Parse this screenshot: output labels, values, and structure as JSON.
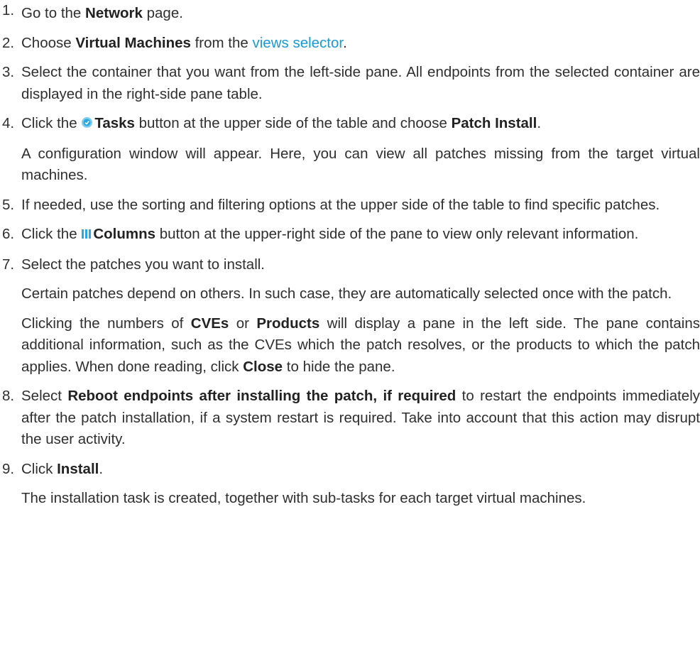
{
  "steps": [
    {
      "num": "1.",
      "pre": "Go to the ",
      "b1": "Network",
      "post": " page."
    },
    {
      "num": "2.",
      "pre": "Choose ",
      "b1": "Virtual Machines",
      "mid": " from the ",
      "link": "views selector",
      "post": "."
    },
    {
      "num": "3.",
      "text": "Select the container that you want from the left-side pane. All endpoints from the selected container are displayed in the right-side pane table."
    },
    {
      "num": "4.",
      "pre": "Click the ",
      "b1": "Tasks",
      "mid": " button at the upper side of the table and choose ",
      "b2": "Patch Install",
      "post": ".",
      "sub": "A configuration window will appear. Here, you can view all patches missing from the target virtual machines."
    },
    {
      "num": "5.",
      "text": "If needed, use the sorting and filtering options at the upper side of the table to find specific patches."
    },
    {
      "num": "6.",
      "pre": "Click the ",
      "b1": "Columns",
      "post": " button at the upper-right side of the pane to view only relevant information."
    },
    {
      "num": "7.",
      "text": "Select the patches you want to install.",
      "sub1": "Certain patches depend on others. In such case, they are automatically selected once with the patch.",
      "sub2_pre": "Clicking the numbers of ",
      "sub2_b1": "CVEs",
      "sub2_mid": " or ",
      "sub2_b2": "Products",
      "sub2_post": " will display a pane in the left side. The pane contains additional information, such as the CVEs which the patch resolves, or the products to which the patch applies. When done reading, click ",
      "sub2_b3": "Close",
      "sub2_end": " to hide the pane."
    },
    {
      "num": "8.",
      "pre": "Select ",
      "b1": "Reboot endpoints after installing the patch, if required",
      "post": " to restart the endpoints immediately after the patch installation, if a system restart is required. Take into account that this action may disrupt the user activity."
    },
    {
      "num": "9.",
      "pre": "Click ",
      "b1": "Install",
      "post": ".",
      "sub": "The installation task is created, together with sub-tasks for each target virtual machines."
    }
  ],
  "icons": {
    "tasks": "tasks-icon",
    "columns": "columns-icon"
  },
  "colors": {
    "link": "#1a9ad6",
    "icon": "#2aa8e0",
    "text": "#2f2f2f"
  }
}
